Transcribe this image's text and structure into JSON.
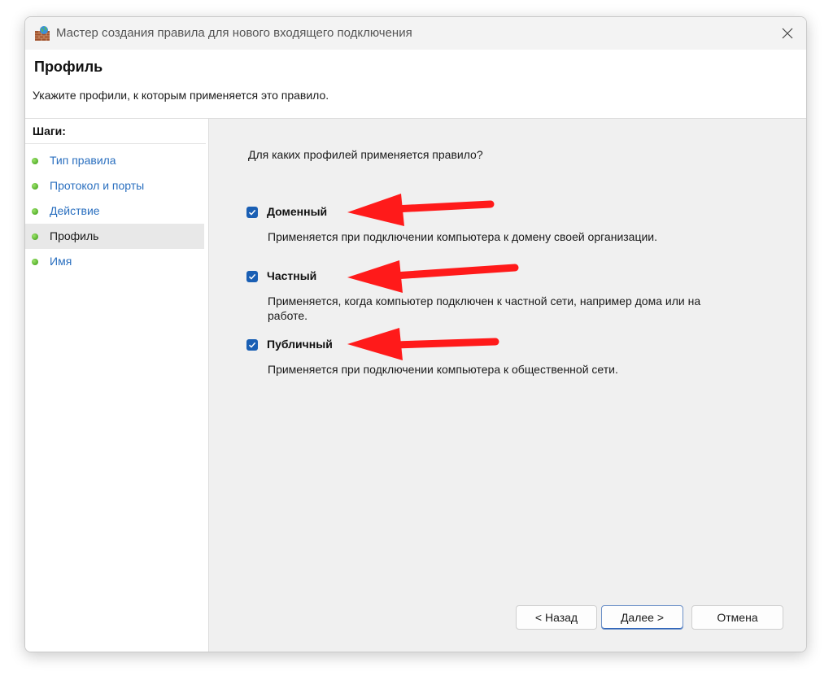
{
  "window": {
    "title": "Мастер создания правила для нового входящего подключения"
  },
  "header": {
    "title": "Профиль",
    "subtitle": "Укажите профили, к которым применяется это правило."
  },
  "sidebar": {
    "steps_label": "Шаги:",
    "items": [
      {
        "label": "Тип правила",
        "active": false
      },
      {
        "label": "Протокол и порты",
        "active": false
      },
      {
        "label": "Действие",
        "active": false
      },
      {
        "label": "Профиль",
        "active": true
      },
      {
        "label": "Имя",
        "active": false
      }
    ]
  },
  "main": {
    "question": "Для каких профилей применяется правило?",
    "options": [
      {
        "label": "Доменный",
        "checked": true,
        "description": "Применяется при подключении компьютера к домену своей организации."
      },
      {
        "label": "Частный",
        "checked": true,
        "description": "Применяется, когда компьютер подключен к частной сети, например дома или на работе."
      },
      {
        "label": "Публичный",
        "checked": true,
        "description": "Применяется при подключении компьютера к общественной сети."
      }
    ]
  },
  "buttons": {
    "back": "< Назад",
    "next": "Далее >",
    "cancel": "Отмена"
  },
  "colors": {
    "checkbox": "#1a5fb4",
    "arrow": "#ff1a1a",
    "step_link": "#2a6fbf",
    "step_dot": "#3a9a14"
  },
  "icons": {
    "app": "firewall-brick-icon",
    "close": "close-icon",
    "check": "checkmark-icon",
    "annotation": "red-arrow-icon"
  }
}
